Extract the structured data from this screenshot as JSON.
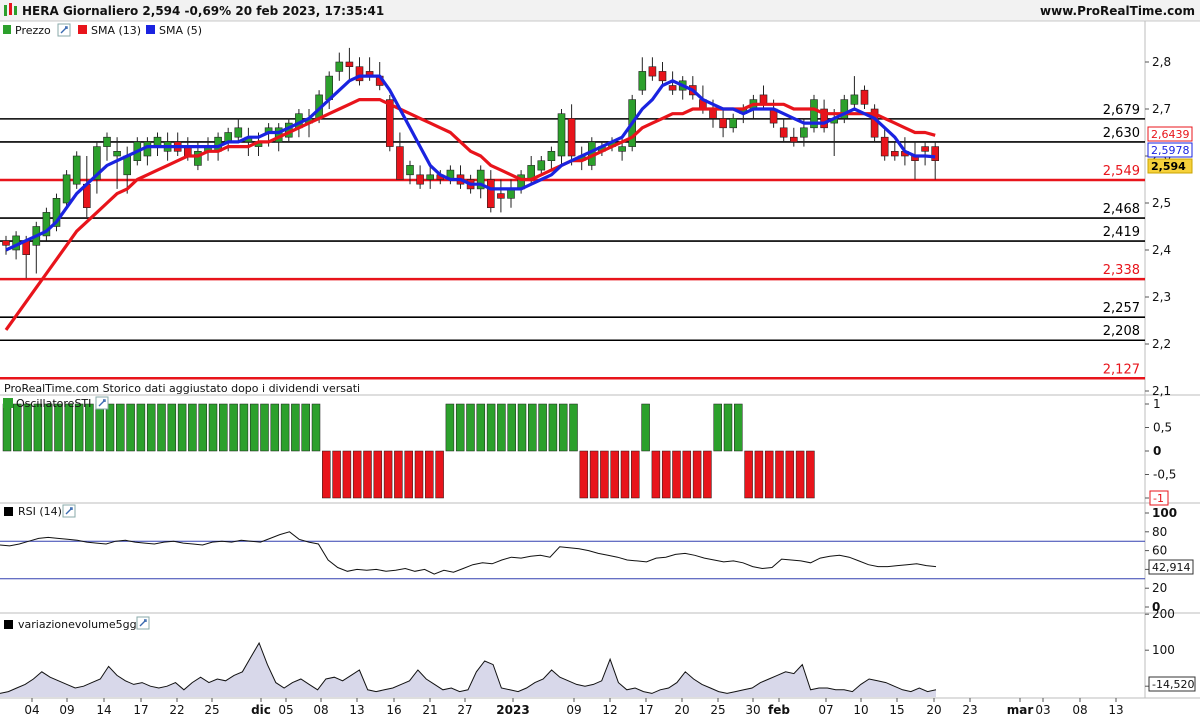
{
  "header": {
    "title": "HERA Giornaliero 2,594 -0,69% 20 feb 2023, 17:35:41",
    "brand": "www.ProRealTime.com"
  },
  "price_panel": {
    "legend": [
      {
        "label": "Prezzo",
        "color": "#2ca02c"
      },
      {
        "label": "SMA (13)",
        "color": "#e8141b"
      },
      {
        "label": "SMA (5)",
        "color": "#1a23e0"
      }
    ],
    "footnote": "ProRealTime.com  Storico dati aggiustato dopo i dividendi versati"
  },
  "osc_panel": {
    "title": "OscillatoreSTI"
  },
  "rsi_panel": {
    "title": "RSI (14)"
  },
  "vol_panel": {
    "title": "variazionevolume5gg"
  },
  "colors": {
    "up": "#2ca02c",
    "down": "#e8141b",
    "sma13": "#e8141b",
    "sma5": "#1a23e0",
    "rsi_band": "#3340b0",
    "vol_fill": "#d8d8ea",
    "vol_line": "#111111"
  },
  "chart_data": [
    {
      "type": "candlestick",
      "title": "HERA Giornaliero",
      "ylim": [
        2.1,
        2.85
      ],
      "y_ticks": [
        2.1,
        2.2,
        2.3,
        2.4,
        2.5,
        2.6,
        2.7,
        2.8
      ],
      "y_tick_labels": [
        "2,1",
        "2,2",
        "2,3",
        "2,4",
        "2,5",
        "2,6",
        "2,7",
        "2,8"
      ],
      "x_ticks": [
        "04",
        "09",
        "14",
        "17",
        "22",
        "25",
        "dic",
        "05",
        "08",
        "13",
        "16",
        "21",
        "27",
        "2023",
        "09",
        "12",
        "17",
        "20",
        "25",
        "30",
        "feb",
        "07",
        "10",
        "15",
        "20",
        "23",
        "mar",
        "03",
        "08",
        "13"
      ],
      "horizontal_levels": [
        {
          "value": 2.679,
          "label": "2,679",
          "color": "#000000"
        },
        {
          "value": 2.63,
          "label": "2,630",
          "color": "#000000"
        },
        {
          "value": 2.549,
          "label": "2,549",
          "color": "#e8141b"
        },
        {
          "value": 2.468,
          "label": "2,468",
          "color": "#000000"
        },
        {
          "value": 2.419,
          "label": "2,419",
          "color": "#000000"
        },
        {
          "value": 2.338,
          "label": "2,338",
          "color": "#e8141b"
        },
        {
          "value": 2.257,
          "label": "2,257",
          "color": "#000000"
        },
        {
          "value": 2.208,
          "label": "2,208",
          "color": "#000000"
        },
        {
          "value": 2.127,
          "label": "2,127",
          "color": "#e8141b"
        }
      ],
      "last_value_labels": [
        {
          "label": "2,6439",
          "series": "SMA (13)"
        },
        {
          "label": "2,5978",
          "series": "SMA (5)"
        },
        {
          "label": "2,594",
          "series": "Prezzo"
        }
      ],
      "candles": [
        [
          2.42,
          2.43,
          2.39,
          2.41
        ],
        [
          2.4,
          2.44,
          2.38,
          2.43
        ],
        [
          2.42,
          2.43,
          2.34,
          2.39
        ],
        [
          2.41,
          2.46,
          2.35,
          2.45
        ],
        [
          2.43,
          2.49,
          2.42,
          2.48
        ],
        [
          2.45,
          2.52,
          2.44,
          2.51
        ],
        [
          2.5,
          2.57,
          2.49,
          2.56
        ],
        [
          2.54,
          2.61,
          2.53,
          2.6
        ],
        [
          2.54,
          2.6,
          2.47,
          2.49
        ],
        [
          2.55,
          2.63,
          2.52,
          2.62
        ],
        [
          2.62,
          2.65,
          2.59,
          2.64
        ],
        [
          2.6,
          2.64,
          2.53,
          2.61
        ],
        [
          2.56,
          2.62,
          2.52,
          2.6
        ],
        [
          2.59,
          2.64,
          2.58,
          2.63
        ],
        [
          2.6,
          2.64,
          2.58,
          2.63
        ],
        [
          2.62,
          2.65,
          2.6,
          2.64
        ],
        [
          2.61,
          2.65,
          2.59,
          2.63
        ],
        [
          2.63,
          2.65,
          2.6,
          2.61
        ],
        [
          2.62,
          2.64,
          2.59,
          2.6
        ],
        [
          2.58,
          2.63,
          2.57,
          2.61
        ],
        [
          2.61,
          2.64,
          2.59,
          2.62
        ],
        [
          2.61,
          2.65,
          2.59,
          2.64
        ],
        [
          2.63,
          2.66,
          2.61,
          2.65
        ],
        [
          2.64,
          2.68,
          2.63,
          2.66
        ],
        [
          2.63,
          2.66,
          2.6,
          2.64
        ],
        [
          2.62,
          2.65,
          2.6,
          2.63
        ],
        [
          2.65,
          2.67,
          2.62,
          2.66
        ],
        [
          2.63,
          2.67,
          2.61,
          2.66
        ],
        [
          2.64,
          2.68,
          2.63,
          2.67
        ],
        [
          2.66,
          2.7,
          2.64,
          2.69
        ],
        [
          2.67,
          2.7,
          2.64,
          2.68
        ],
        [
          2.68,
          2.74,
          2.67,
          2.73
        ],
        [
          2.72,
          2.78,
          2.7,
          2.77
        ],
        [
          2.78,
          2.82,
          2.76,
          2.8
        ],
        [
          2.8,
          2.83,
          2.76,
          2.79
        ],
        [
          2.79,
          2.81,
          2.75,
          2.76
        ],
        [
          2.78,
          2.81,
          2.76,
          2.77
        ],
        [
          2.77,
          2.8,
          2.74,
          2.75
        ],
        [
          2.72,
          2.73,
          2.61,
          2.62
        ],
        [
          2.62,
          2.65,
          2.55,
          2.55
        ],
        [
          2.56,
          2.59,
          2.54,
          2.58
        ],
        [
          2.56,
          2.58,
          2.53,
          2.54
        ],
        [
          2.55,
          2.58,
          2.53,
          2.56
        ],
        [
          2.56,
          2.57,
          2.54,
          2.55
        ],
        [
          2.55,
          2.58,
          2.54,
          2.57
        ],
        [
          2.56,
          2.58,
          2.53,
          2.54
        ],
        [
          2.55,
          2.56,
          2.52,
          2.53
        ],
        [
          2.53,
          2.58,
          2.51,
          2.57
        ],
        [
          2.55,
          2.57,
          2.48,
          2.49
        ],
        [
          2.52,
          2.55,
          2.48,
          2.51
        ],
        [
          2.51,
          2.55,
          2.49,
          2.53
        ],
        [
          2.53,
          2.57,
          2.52,
          2.56
        ],
        [
          2.55,
          2.6,
          2.54,
          2.58
        ],
        [
          2.57,
          2.6,
          2.56,
          2.59
        ],
        [
          2.59,
          2.62,
          2.57,
          2.61
        ],
        [
          2.6,
          2.7,
          2.58,
          2.69
        ],
        [
          2.68,
          2.71,
          2.58,
          2.6
        ],
        [
          2.59,
          2.62,
          2.57,
          2.6
        ],
        [
          2.58,
          2.64,
          2.57,
          2.63
        ],
        [
          2.61,
          2.63,
          2.6,
          2.62
        ],
        [
          2.62,
          2.64,
          2.61,
          2.63
        ],
        [
          2.61,
          2.64,
          2.59,
          2.62
        ],
        [
          2.62,
          2.73,
          2.61,
          2.72
        ],
        [
          2.74,
          2.81,
          2.73,
          2.78
        ],
        [
          2.79,
          2.81,
          2.76,
          2.77
        ],
        [
          2.78,
          2.8,
          2.75,
          2.76
        ],
        [
          2.75,
          2.78,
          2.73,
          2.74
        ],
        [
          2.74,
          2.77,
          2.72,
          2.76
        ],
        [
          2.75,
          2.77,
          2.72,
          2.73
        ],
        [
          2.72,
          2.75,
          2.69,
          2.7
        ],
        [
          2.7,
          2.72,
          2.66,
          2.68
        ],
        [
          2.68,
          2.7,
          2.64,
          2.66
        ],
        [
          2.66,
          2.69,
          2.65,
          2.68
        ],
        [
          2.69,
          2.71,
          2.67,
          2.7
        ],
        [
          2.7,
          2.73,
          2.68,
          2.72
        ],
        [
          2.73,
          2.75,
          2.7,
          2.71
        ],
        [
          2.7,
          2.72,
          2.66,
          2.67
        ],
        [
          2.66,
          2.68,
          2.63,
          2.64
        ],
        [
          2.64,
          2.66,
          2.62,
          2.63
        ],
        [
          2.64,
          2.68,
          2.62,
          2.66
        ],
        [
          2.66,
          2.73,
          2.65,
          2.72
        ],
        [
          2.7,
          2.72,
          2.65,
          2.66
        ],
        [
          2.67,
          2.7,
          2.6,
          2.68
        ],
        [
          2.68,
          2.73,
          2.67,
          2.72
        ],
        [
          2.71,
          2.77,
          2.7,
          2.73
        ],
        [
          2.74,
          2.75,
          2.7,
          2.71
        ],
        [
          2.7,
          2.71,
          2.63,
          2.64
        ],
        [
          2.64,
          2.66,
          2.59,
          2.6
        ],
        [
          2.61,
          2.63,
          2.59,
          2.6
        ],
        [
          2.61,
          2.64,
          2.58,
          2.6
        ],
        [
          2.6,
          2.63,
          2.55,
          2.59
        ],
        [
          2.62,
          2.63,
          2.58,
          2.61
        ],
        [
          2.62,
          2.63,
          2.55,
          2.59
        ]
      ],
      "series": [
        {
          "name": "SMA (13)",
          "values": [
            2.23,
            2.26,
            2.29,
            2.32,
            2.35,
            2.38,
            2.41,
            2.44,
            2.46,
            2.48,
            2.5,
            2.52,
            2.53,
            2.55,
            2.56,
            2.57,
            2.58,
            2.59,
            2.6,
            2.6,
            2.61,
            2.61,
            2.62,
            2.62,
            2.62,
            2.63,
            2.63,
            2.64,
            2.65,
            2.66,
            2.67,
            2.68,
            2.69,
            2.7,
            2.71,
            2.72,
            2.72,
            2.72,
            2.71,
            2.7,
            2.69,
            2.68,
            2.67,
            2.66,
            2.65,
            2.63,
            2.61,
            2.6,
            2.58,
            2.57,
            2.56,
            2.55,
            2.55,
            2.56,
            2.57,
            2.58,
            2.59,
            2.59,
            2.6,
            2.61,
            2.62,
            2.63,
            2.64,
            2.66,
            2.67,
            2.68,
            2.69,
            2.69,
            2.7,
            2.7,
            2.7,
            2.7,
            2.7,
            2.7,
            2.71,
            2.71,
            2.71,
            2.71,
            2.7,
            2.7,
            2.7,
            2.69,
            2.69,
            2.69,
            2.69,
            2.69,
            2.69,
            2.68,
            2.67,
            2.66,
            2.65,
            2.65,
            2.644
          ]
        },
        {
          "name": "SMA (5)",
          "values": [
            2.4,
            2.41,
            2.42,
            2.43,
            2.44,
            2.46,
            2.49,
            2.52,
            2.54,
            2.56,
            2.58,
            2.59,
            2.6,
            2.61,
            2.62,
            2.62,
            2.62,
            2.62,
            2.62,
            2.62,
            2.62,
            2.62,
            2.63,
            2.63,
            2.64,
            2.64,
            2.65,
            2.65,
            2.66,
            2.67,
            2.68,
            2.7,
            2.72,
            2.74,
            2.76,
            2.77,
            2.77,
            2.77,
            2.74,
            2.7,
            2.66,
            2.62,
            2.58,
            2.56,
            2.55,
            2.55,
            2.54,
            2.54,
            2.53,
            2.53,
            2.53,
            2.53,
            2.54,
            2.55,
            2.56,
            2.58,
            2.59,
            2.6,
            2.61,
            2.62,
            2.63,
            2.64,
            2.67,
            2.7,
            2.72,
            2.75,
            2.76,
            2.75,
            2.74,
            2.72,
            2.71,
            2.7,
            2.7,
            2.69,
            2.7,
            2.7,
            2.7,
            2.69,
            2.68,
            2.67,
            2.67,
            2.67,
            2.68,
            2.69,
            2.7,
            2.69,
            2.68,
            2.66,
            2.64,
            2.61,
            2.6,
            2.6,
            2.598
          ]
        }
      ]
    },
    {
      "type": "bar",
      "title": "OscillatoreSTI",
      "ylim": [
        -1,
        1
      ],
      "y_ticks": [
        -1,
        -0.5,
        0,
        0.5,
        1
      ],
      "y_tick_labels": [
        "-1",
        "-0,5",
        "0",
        "0,5",
        "1"
      ],
      "values": [
        1,
        1,
        1,
        1,
        1,
        1,
        1,
        1,
        1,
        1,
        1,
        1,
        1,
        1,
        1,
        1,
        1,
        1,
        1,
        1,
        1,
        1,
        1,
        1,
        1,
        1,
        1,
        1,
        1,
        1,
        1,
        -1,
        -1,
        -1,
        -1,
        -1,
        -1,
        -1,
        -1,
        -1,
        -1,
        -1,
        -1,
        1,
        1,
        1,
        1,
        1,
        1,
        1,
        1,
        1,
        1,
        1,
        1,
        1,
        -1,
        -1,
        -1,
        -1,
        -1,
        -1,
        1,
        -1,
        -1,
        -1,
        -1,
        -1,
        -1,
        1,
        1,
        1,
        -1,
        -1,
        -1,
        -1,
        -1,
        -1,
        -1
      ]
    },
    {
      "type": "line",
      "title": "RSI (14)",
      "ylim": [
        0,
        100
      ],
      "y_ticks": [
        0,
        20,
        40,
        60,
        80,
        100
      ],
      "bands": [
        70,
        30
      ],
      "last_value_label": "42,914",
      "values": [
        66,
        65,
        67,
        70,
        73,
        74,
        73,
        72,
        71,
        69,
        68,
        67,
        70,
        71,
        69,
        68,
        67,
        69,
        70,
        68,
        67,
        66,
        69,
        70,
        69,
        71,
        70,
        69,
        73,
        77,
        80,
        72,
        69,
        67,
        50,
        42,
        38,
        40,
        39,
        40,
        38,
        39,
        41,
        38,
        40,
        35,
        39,
        37,
        41,
        45,
        47,
        46,
        50,
        53,
        52,
        54,
        55,
        53,
        64,
        63,
        62,
        60,
        57,
        55,
        53,
        50,
        49,
        48,
        52,
        53,
        56,
        57,
        55,
        52,
        50,
        48,
        49,
        47,
        43,
        41,
        42,
        51,
        50,
        49,
        47,
        52,
        54,
        55,
        53,
        49,
        45,
        43,
        43,
        44,
        45,
        46,
        44,
        43
      ]
    },
    {
      "type": "area",
      "title": "variazionevolume5gg",
      "ylim": [
        -30,
        210
      ],
      "y_ticks": [
        0,
        100,
        200
      ],
      "last_value_label": "-14,520",
      "values": [
        -20,
        -15,
        -5,
        5,
        20,
        40,
        25,
        15,
        5,
        -5,
        0,
        10,
        20,
        55,
        30,
        15,
        5,
        10,
        0,
        -5,
        0,
        10,
        -10,
        10,
        25,
        10,
        20,
        15,
        30,
        40,
        80,
        120,
        60,
        10,
        -5,
        10,
        20,
        5,
        -10,
        20,
        25,
        15,
        30,
        45,
        -10,
        -15,
        -10,
        -5,
        5,
        15,
        45,
        20,
        5,
        -10,
        -5,
        -15,
        -10,
        40,
        70,
        60,
        -5,
        -10,
        -15,
        -5,
        10,
        20,
        45,
        25,
        15,
        5,
        0,
        5,
        15,
        75,
        10,
        -10,
        -5,
        -15,
        -20,
        -10,
        -5,
        10,
        40,
        20,
        5,
        -5,
        -15,
        -20,
        -15,
        -10,
        -5,
        10,
        20,
        30,
        40,
        35,
        60,
        -10,
        -5,
        -5,
        -10,
        -10,
        -15,
        5,
        20,
        15,
        10,
        0,
        -10,
        -15,
        -5,
        -15,
        -10
      ]
    }
  ]
}
